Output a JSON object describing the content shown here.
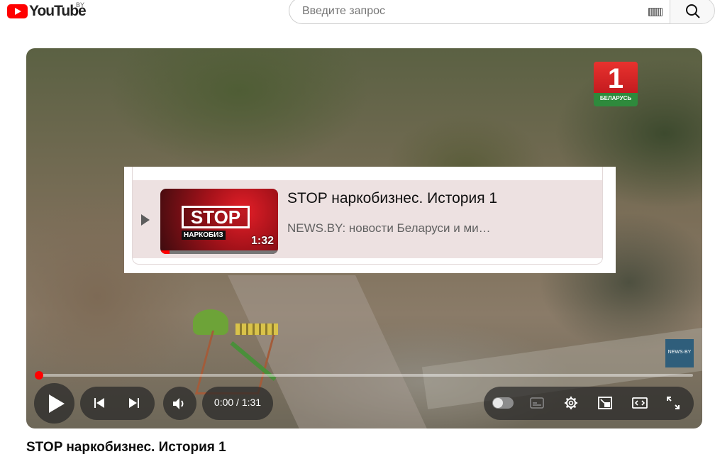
{
  "app": {
    "logo_text": "YouTube",
    "region_code": "BY"
  },
  "search": {
    "placeholder": "Введите запрос",
    "keyboard_icon": "keyboard-icon",
    "button_icon": "search-icon"
  },
  "player": {
    "channel_logo": {
      "number": "1",
      "label": "БЕЛАРУСЬ"
    },
    "watermark": "NEWS·BY",
    "progress_fraction": 0.0,
    "time": "0:00 / 1:31",
    "controls": {
      "play_icon": "play-icon",
      "prev_icon": "skip-previous-icon",
      "next_icon": "skip-next-icon",
      "volume_icon": "volume-icon",
      "autoplay_icon": "autoplay-toggle-icon",
      "subtitles_icon": "subtitles-icon",
      "settings_icon": "gear-icon",
      "miniplayer_icon": "miniplayer-icon",
      "theater_icon": "theater-mode-icon",
      "fullscreen_icon": "fullscreen-icon"
    }
  },
  "overlay_item": {
    "thumbnail_text": "STOP",
    "thumbnail_subtext": "НАРКОБИЗ",
    "duration": "1:32",
    "watched_fraction": 0.08,
    "title": "STOP наркобизнес. История 1",
    "channel": "NEWS.BY: новости Беларуси и ми…"
  },
  "video": {
    "title": "STOP наркобизнес. История 1"
  },
  "colors": {
    "brand_red": "#ff0000",
    "overlay_row_bg": "#ede1e1"
  }
}
